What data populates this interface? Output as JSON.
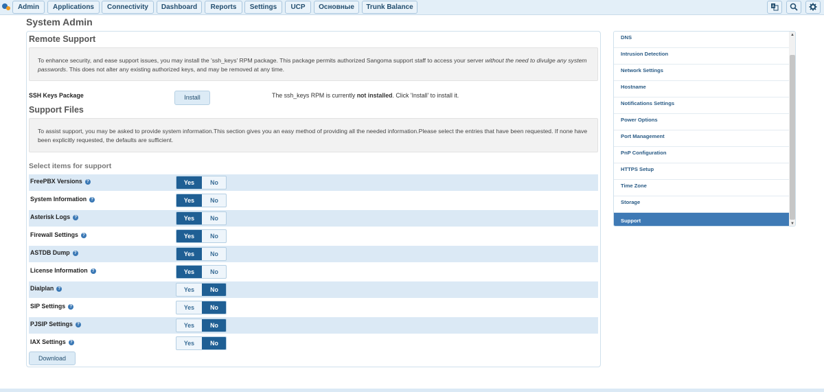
{
  "nav": {
    "items": [
      "Admin",
      "Applications",
      "Connectivity",
      "Dashboard",
      "Reports",
      "Settings",
      "UCP",
      "Основные",
      "Trunk Balance"
    ],
    "icons": [
      "translate-icon",
      "search-icon",
      "gear-icon"
    ]
  },
  "page": {
    "title": "System Admin"
  },
  "remote": {
    "title": "Remote Support",
    "info_a": "To enhance security, and ease support issues, you may install the 'ssh_keys' RPM package. This package permits authorized Sangoma support staff to access your server ",
    "info_em": "without the need to divulge any system passwords",
    "info_b": ". This does not alter any existing authorized keys, and may be removed at any time.",
    "ssh_label": "SSH Keys Package",
    "install_label": "Install",
    "status_a": "The ssh_keys RPM is currently ",
    "status_b": "not installed",
    "status_c": ". Click 'Install' to install it."
  },
  "support": {
    "title": "Support Files",
    "info": "To assist support, you may be asked to provide system information.This section gives you an easy method of providing all the needed information.Please select the entries that have been requested. If none have been explicitly requested, the defaults are sufficient.",
    "select_title": "Select items for support",
    "yes_label": "Yes",
    "no_label": "No",
    "help_glyph": "?",
    "items": [
      {
        "label": "FreePBX Versions",
        "selected": "Yes"
      },
      {
        "label": "System Information",
        "selected": "Yes"
      },
      {
        "label": "Asterisk Logs",
        "selected": "Yes"
      },
      {
        "label": "Firewall Settings",
        "selected": "Yes"
      },
      {
        "label": "ASTDB Dump",
        "selected": "Yes"
      },
      {
        "label": "License Information",
        "selected": "Yes"
      },
      {
        "label": "Dialplan",
        "selected": "No"
      },
      {
        "label": "SIP Settings",
        "selected": "No"
      },
      {
        "label": "PJSIP Settings",
        "selected": "No"
      },
      {
        "label": "IAX Settings",
        "selected": "No"
      }
    ],
    "download_label": "Download"
  },
  "sidebar": {
    "items": [
      "DNS",
      "Intrusion Detection",
      "Network Settings",
      "Hostname",
      "Notifications Settings",
      "Power Options",
      "Port Management",
      "PnP Configuration",
      "HTTPS Setup",
      "Time Zone",
      "Storage",
      "Support"
    ],
    "active": "Support"
  },
  "colors": {
    "accent": "#1f5f94",
    "nav_bg": "#e3eff8",
    "row_shade": "#dbe9f5",
    "sidebar_active": "#3f7ab5"
  }
}
